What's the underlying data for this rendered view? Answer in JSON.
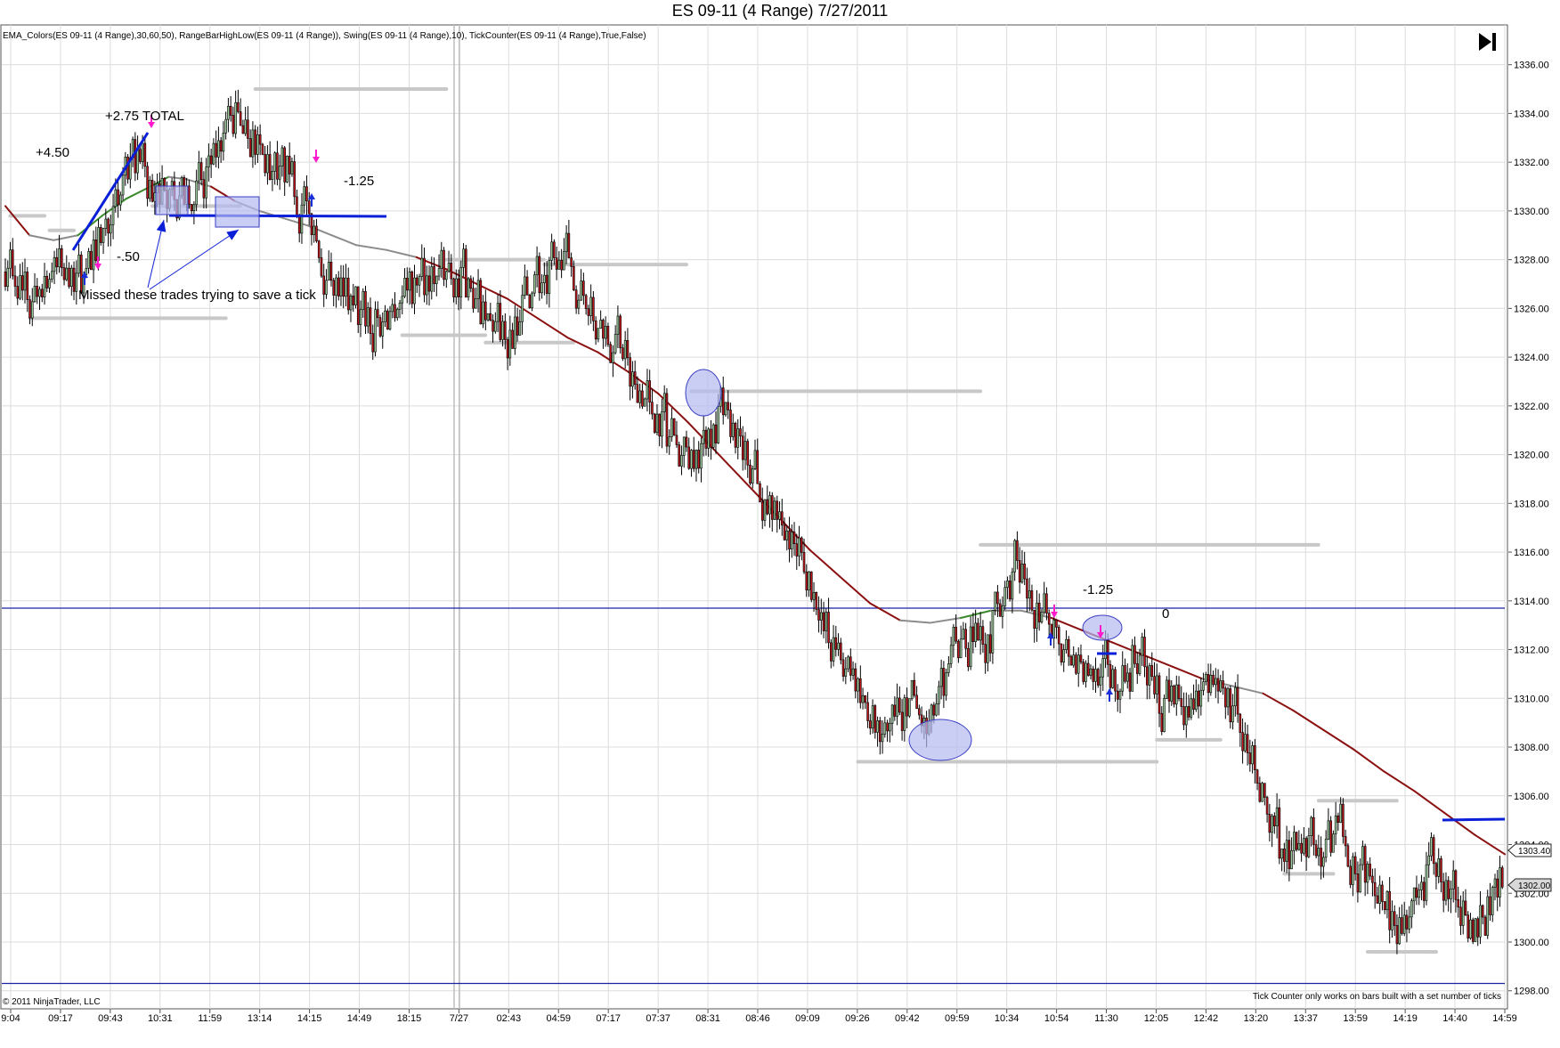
{
  "header": {
    "title": "ES 09-11 (4 Range)  7/27/2011"
  },
  "indicator_line": "EMA_Colors(ES 09-11 (4 Range),30,60,50), RangeBarHighLow(ES 09-11 (4 Range)), Swing(ES 09-11 (4 Range),10), TickCounter(ES 09-11 (4 Range),True,False)",
  "footer": {
    "copyright": "© 2011 NinjaTrader, LLC",
    "tick_note": "Tick Counter only works on bars built with a set number of ticks"
  },
  "price_tags": {
    "current": "1303.40",
    "last": "1302.00"
  },
  "annotations": {
    "total": "+2.75 TOTAL",
    "first_trade": "+4.50",
    "loss_small": "-.50",
    "loss_a": "-1.25",
    "loss_b": "-1.25",
    "zero": "0",
    "missed": "Missed these trades trying to save a tick"
  },
  "colors": {
    "bull_candle": "#9ccc9c",
    "bear_candle": "#c0161c",
    "ema_up": "#3a8a2a",
    "ema_flat": "#8c8c8c",
    "ema_down": "#8b1010",
    "range_dots": "#c8c8c8",
    "annotation_blue": "#0a1fd8",
    "highlight_fill": "#b4b8f0",
    "signal_magenta": "#ff1acb",
    "horizontal_line": "#1b22a6",
    "grid": "#dcdcdc"
  },
  "chart_data": {
    "type": "candlestick",
    "title": "ES 09-11 (4 Range)  7/27/2011",
    "instrument": "ES 09-11",
    "bar_type": "4 Range",
    "ylim": [
      1297,
      1337
    ],
    "y_ticks": [
      "1336.00",
      "1334.00",
      "1332.00",
      "1330.00",
      "1328.00",
      "1326.00",
      "1324.00",
      "1322.00",
      "1320.00",
      "1318.00",
      "1316.00",
      "1314.00",
      "1312.00",
      "1310.00",
      "1308.00",
      "1306.00",
      "1304.00",
      "1302.00",
      "1300.00",
      "1298.00"
    ],
    "x_ticks": [
      "9:04",
      "09:17",
      "09:43",
      "10:31",
      "11:59",
      "13:14",
      "14:15",
      "14:49",
      "18:15",
      "7/27",
      "02:43",
      "04:59",
      "07:17",
      "07:37",
      "08:31",
      "08:46",
      "09:09",
      "09:26",
      "09:42",
      "09:59",
      "10:34",
      "10:54",
      "11:30",
      "12:05",
      "12:42",
      "13:20",
      "13:37",
      "13:59",
      "14:19",
      "14:40",
      "14:59"
    ],
    "path": [
      [
        0,
        1327.5
      ],
      [
        10,
        1326.4
      ],
      [
        20,
        1327.6
      ],
      [
        30,
        1327.0
      ],
      [
        40,
        1329.2
      ],
      [
        48,
        1331.0
      ],
      [
        55,
        1332.4
      ],
      [
        60,
        1330.2
      ],
      [
        66,
        1331.5
      ],
      [
        72,
        1330.0
      ],
      [
        80,
        1331.2
      ],
      [
        88,
        1332.8
      ],
      [
        92,
        1334.2
      ],
      [
        98,
        1333.5
      ],
      [
        104,
        1332.4
      ],
      [
        110,
        1331.2
      ],
      [
        116,
        1331.8
      ],
      [
        120,
        1330.5
      ],
      [
        126,
        1329.2
      ],
      [
        132,
        1327.4
      ],
      [
        140,
        1326.2
      ],
      [
        148,
        1325.2
      ],
      [
        156,
        1325.8
      ],
      [
        164,
        1326.6
      ],
      [
        172,
        1327.2
      ],
      [
        180,
        1327.6
      ],
      [
        188,
        1327.0
      ],
      [
        196,
        1325.5
      ],
      [
        204,
        1325.0
      ],
      [
        212,
        1326.2
      ],
      [
        220,
        1327.3
      ],
      [
        228,
        1327.9
      ],
      [
        236,
        1326.6
      ],
      [
        244,
        1325.2
      ],
      [
        252,
        1324.0
      ],
      [
        260,
        1322.4
      ],
      [
        268,
        1321.2
      ],
      [
        274,
        1320.2
      ],
      [
        280,
        1319.7
      ],
      [
        286,
        1320.8
      ],
      [
        292,
        1322.0
      ],
      [
        298,
        1320.8
      ],
      [
        304,
        1319.2
      ],
      [
        310,
        1318.0
      ],
      [
        316,
        1317.5
      ],
      [
        322,
        1316.3
      ],
      [
        328,
        1314.8
      ],
      [
        334,
        1313.2
      ],
      [
        340,
        1311.7
      ],
      [
        346,
        1311.0
      ],
      [
        352,
        1309.5
      ],
      [
        358,
        1308.4
      ],
      [
        364,
        1309.2
      ],
      [
        370,
        1309.9
      ],
      [
        376,
        1308.6
      ],
      [
        382,
        1310.3
      ],
      [
        388,
        1311.8
      ],
      [
        394,
        1313.0
      ],
      [
        400,
        1312.5
      ],
      [
        406,
        1313.8
      ],
      [
        412,
        1315.9
      ],
      [
        418,
        1314.0
      ],
      [
        424,
        1313.0
      ],
      [
        430,
        1312.6
      ],
      [
        436,
        1311.7
      ],
      [
        442,
        1310.7
      ],
      [
        448,
        1311.3
      ],
      [
        454,
        1310.4
      ],
      [
        460,
        1311.8
      ],
      [
        466,
        1311.2
      ],
      [
        472,
        1309.6
      ],
      [
        478,
        1310.4
      ],
      [
        484,
        1309.0
      ],
      [
        490,
        1310.8
      ],
      [
        496,
        1310.2
      ],
      [
        502,
        1309.2
      ],
      [
        508,
        1307.5
      ],
      [
        514,
        1305.5
      ],
      [
        520,
        1304.0
      ],
      [
        526,
        1303.2
      ],
      [
        532,
        1304.5
      ],
      [
        538,
        1303.6
      ],
      [
        544,
        1304.7
      ],
      [
        550,
        1303.2
      ],
      [
        556,
        1302.4
      ],
      [
        562,
        1301.3
      ],
      [
        568,
        1300.3
      ],
      [
        574,
        1301.5
      ],
      [
        580,
        1303.6
      ],
      [
        586,
        1303.0
      ],
      [
        592,
        1302.0
      ],
      [
        598,
        1300.2
      ],
      [
        604,
        1301.6
      ],
      [
        610,
        1302.6
      ]
    ],
    "ema_path": [
      [
        0,
        1330.2
      ],
      [
        8,
        1329.0
      ],
      [
        16,
        1328.8
      ],
      [
        24,
        1329.0
      ],
      [
        32,
        1329.8
      ],
      [
        40,
        1330.5
      ],
      [
        48,
        1331.0
      ],
      [
        54,
        1331.4
      ],
      [
        60,
        1331.3
      ],
      [
        68,
        1331.0
      ],
      [
        76,
        1330.4
      ],
      [
        84,
        1330.0
      ],
      [
        92,
        1329.7
      ],
      [
        100,
        1329.4
      ],
      [
        108,
        1329.0
      ],
      [
        116,
        1328.6
      ],
      [
        126,
        1328.4
      ],
      [
        136,
        1328.1
      ],
      [
        146,
        1327.6
      ],
      [
        156,
        1327.0
      ],
      [
        166,
        1326.4
      ],
      [
        176,
        1325.6
      ],
      [
        186,
        1324.8
      ],
      [
        196,
        1324.2
      ],
      [
        206,
        1323.4
      ],
      [
        216,
        1322.5
      ],
      [
        226,
        1321.3
      ],
      [
        236,
        1320.0
      ],
      [
        246,
        1318.7
      ],
      [
        256,
        1317.4
      ],
      [
        266,
        1316.1
      ],
      [
        276,
        1315.0
      ],
      [
        286,
        1313.9
      ],
      [
        296,
        1313.2
      ],
      [
        306,
        1313.1
      ],
      [
        316,
        1313.3
      ],
      [
        326,
        1313.6
      ],
      [
        336,
        1313.6
      ],
      [
        346,
        1313.3
      ],
      [
        356,
        1312.8
      ],
      [
        366,
        1312.3
      ],
      [
        376,
        1311.8
      ],
      [
        386,
        1311.3
      ],
      [
        396,
        1310.8
      ],
      [
        406,
        1310.5
      ],
      [
        416,
        1310.2
      ],
      [
        426,
        1309.5
      ],
      [
        436,
        1308.7
      ],
      [
        446,
        1307.9
      ],
      [
        456,
        1307.0
      ],
      [
        466,
        1306.2
      ],
      [
        476,
        1305.3
      ],
      [
        486,
        1304.4
      ],
      [
        496,
        1303.6
      ]
    ],
    "swing_levels": [
      {
        "y": 1329.8,
        "x0": 2,
        "x1": 16
      },
      {
        "y": 1325.6,
        "x0": 10,
        "x1": 90
      },
      {
        "y": 1329.2,
        "x0": 18,
        "x1": 28
      },
      {
        "y": 1335.0,
        "x0": 102,
        "x1": 180
      },
      {
        "y": 1330.2,
        "x0": 60,
        "x1": 96
      },
      {
        "y": 1328.0,
        "x0": 180,
        "x1": 220
      },
      {
        "y": 1327.8,
        "x0": 220,
        "x1": 278
      },
      {
        "y": 1324.9,
        "x0": 162,
        "x1": 196
      },
      {
        "y": 1324.6,
        "x0": 196,
        "x1": 232
      },
      {
        "y": 1322.6,
        "x0": 280,
        "x1": 398
      },
      {
        "y": 1316.3,
        "x0": 398,
        "x1": 536
      },
      {
        "y": 1307.4,
        "x0": 348,
        "x1": 470
      },
      {
        "y": 1308.3,
        "x0": 470,
        "x1": 496
      },
      {
        "y": 1305.8,
        "x0": 536,
        "x1": 568
      },
      {
        "y": 1302.8,
        "x0": 522,
        "x1": 542
      },
      {
        "y": 1299.6,
        "x0": 556,
        "x1": 584
      }
    ],
    "horizontal_lines": [
      1313.7,
      1298.3
    ],
    "last_price": 1302.0,
    "current_price": 1303.4
  }
}
